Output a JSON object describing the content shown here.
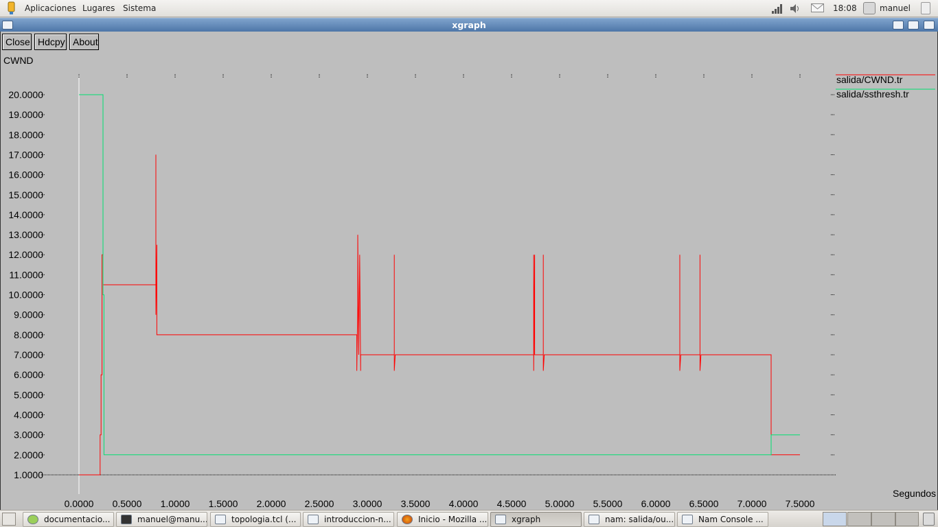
{
  "top_panel": {
    "menus": [
      "Aplicaciones",
      "Lugares",
      "Sistema"
    ],
    "clock": "18:08",
    "user": "manuel",
    "icons": [
      "network-signal-icon",
      "volume-icon",
      "mail-icon"
    ]
  },
  "window": {
    "title": "xgraph"
  },
  "toolbar": {
    "close_label": "Close",
    "hdcpy_label": "Hdcpy",
    "about_label": "About"
  },
  "chart_data": {
    "type": "line",
    "title": "",
    "ylabel": "CWND",
    "xlabel": "Segundos",
    "xlim": [
      -0.1,
      7.5
    ],
    "ylim": [
      1.0,
      20.0
    ],
    "grid": false,
    "legend_position": "top-right",
    "x_ticks": [
      "0.0000",
      "0.5000",
      "1.0000",
      "1.5000",
      "2.0000",
      "2.5000",
      "3.0000",
      "3.5000",
      "4.0000",
      "4.5000",
      "5.0000",
      "5.5000",
      "6.0000",
      "6.5000",
      "7.0000",
      "7.5000"
    ],
    "y_ticks": [
      "1.0000",
      "2.0000",
      "3.0000",
      "4.0000",
      "5.0000",
      "6.0000",
      "7.0000",
      "8.0000",
      "9.0000",
      "10.0000",
      "11.0000",
      "12.0000",
      "13.0000",
      "14.0000",
      "15.0000",
      "16.0000",
      "17.0000",
      "18.0000",
      "19.0000",
      "20.0000"
    ],
    "series": [
      {
        "name": "salida/CWND.tr",
        "color": "#ff0000",
        "points": [
          [
            0.0,
            1.0
          ],
          [
            0.22,
            1.0
          ],
          [
            0.22,
            3.0
          ],
          [
            0.23,
            3.0
          ],
          [
            0.23,
            6.0
          ],
          [
            0.24,
            6.0
          ],
          [
            0.24,
            12.0
          ],
          [
            0.25,
            12.0
          ],
          [
            0.25,
            10.5
          ],
          [
            0.8,
            10.5
          ],
          [
            0.8,
            17.0
          ],
          [
            0.8,
            9.0
          ],
          [
            0.81,
            12.5
          ],
          [
            0.81,
            8.0
          ],
          [
            2.89,
            8.0
          ],
          [
            2.89,
            6.2
          ],
          [
            2.9,
            9.5
          ],
          [
            2.9,
            13.0
          ],
          [
            2.91,
            7.0
          ],
          [
            2.92,
            12.0
          ],
          [
            2.93,
            6.2
          ],
          [
            2.93,
            7.0
          ],
          [
            3.28,
            7.0
          ],
          [
            3.28,
            12.0
          ],
          [
            3.28,
            6.2
          ],
          [
            3.29,
            7.0
          ],
          [
            4.73,
            7.0
          ],
          [
            4.73,
            12.0
          ],
          [
            4.73,
            6.2
          ],
          [
            4.74,
            12.0
          ],
          [
            4.74,
            7.0
          ],
          [
            4.83,
            7.0
          ],
          [
            4.83,
            12.0
          ],
          [
            4.83,
            6.2
          ],
          [
            4.84,
            7.0
          ],
          [
            6.25,
            7.0
          ],
          [
            6.25,
            12.0
          ],
          [
            6.25,
            6.2
          ],
          [
            6.26,
            7.0
          ],
          [
            6.46,
            7.0
          ],
          [
            6.46,
            12.0
          ],
          [
            6.46,
            6.2
          ],
          [
            6.47,
            7.0
          ],
          [
            7.2,
            7.0
          ],
          [
            7.2,
            2.0
          ],
          [
            7.5,
            2.0
          ]
        ]
      },
      {
        "name": "salida/ssthresh.tr",
        "color": "#00e070",
        "points": [
          [
            0.0,
            20.0
          ],
          [
            0.25,
            20.0
          ],
          [
            0.25,
            10.0
          ],
          [
            0.26,
            10.0
          ],
          [
            0.26,
            2.0
          ],
          [
            7.2,
            2.0
          ],
          [
            7.2,
            3.0
          ],
          [
            7.5,
            3.0
          ]
        ]
      }
    ]
  },
  "taskbar": {
    "tasks": [
      {
        "label": "documentacio...",
        "icon": "document-icon"
      },
      {
        "label": "manuel@manu...",
        "icon": "terminal-icon"
      },
      {
        "label": "topologia.tcl (...",
        "icon": "text-editor-icon"
      },
      {
        "label": "introduccion-n...",
        "icon": "window-icon"
      },
      {
        "label": "Inicio - Mozilla ...",
        "icon": "firefox-icon"
      },
      {
        "label": "xgraph",
        "icon": "window-icon",
        "active": true
      },
      {
        "label": "nam: salida/ou...",
        "icon": "window-icon"
      },
      {
        "label": "Nam Console ...",
        "icon": "window-icon"
      }
    ]
  }
}
